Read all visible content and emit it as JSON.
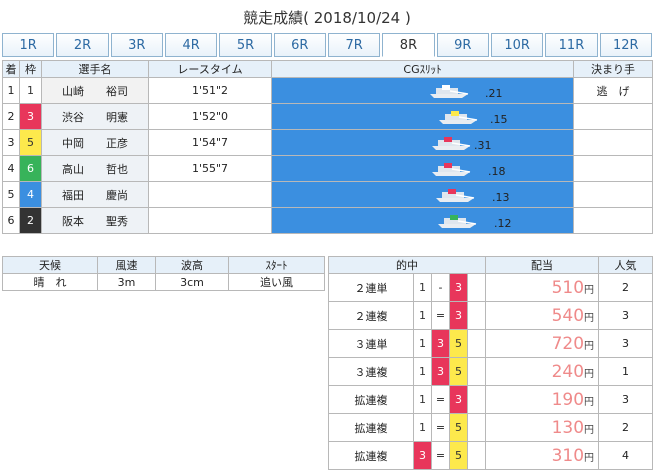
{
  "page": {
    "title": "競走成績( 2018/10/24 )"
  },
  "race_tabs": [
    {
      "label": "1R"
    },
    {
      "label": "2R"
    },
    {
      "label": "3R"
    },
    {
      "label": "4R"
    },
    {
      "label": "5R"
    },
    {
      "label": "6R"
    },
    {
      "label": "7R"
    },
    {
      "label": "8R",
      "active": true
    },
    {
      "label": "9R"
    },
    {
      "label": "10R"
    },
    {
      "label": "11R"
    },
    {
      "label": "12R"
    }
  ],
  "results": {
    "headers": {
      "rank": "着",
      "lane": "枠",
      "name": "選手名",
      "time": "レースタイム",
      "cg": "CGｽﾘｯﾄ",
      "kimarite": "決まり手"
    },
    "rows": [
      {
        "rank": "1",
        "lane": "1",
        "lane_color": "#ffffff",
        "name": "山崎　　裕司",
        "time": "1'51\"2",
        "slit": ".21",
        "kimarite": "逃　げ",
        "boat_color": "#ffffff"
      },
      {
        "rank": "2",
        "lane": "3",
        "lane_color": "#e8365b",
        "name": "渋谷　　明憲",
        "time": "1'52\"0",
        "slit": ".15",
        "kimarite": "",
        "boat_color": "#fde94c"
      },
      {
        "rank": "3",
        "lane": "5",
        "lane_color": "#fde94c",
        "name": "中岡　　正彦",
        "time": "1'54\"7",
        "slit": ".31",
        "kimarite": "",
        "boat_color": "#e8365b"
      },
      {
        "rank": "4",
        "lane": "6",
        "lane_color": "#37b35a",
        "name": "高山　　哲也",
        "time": "1'55\"7",
        "slit": ".18",
        "kimarite": "",
        "boat_color": "#e8365b"
      },
      {
        "rank": "5",
        "lane": "4",
        "lane_color": "#3b8fe0",
        "name": "福田　　慶尚",
        "time": "",
        "slit": ".13",
        "kimarite": "",
        "boat_color": "#e8365b"
      },
      {
        "rank": "6",
        "lane": "2",
        "lane_color": "#333333",
        "name": "阪本　　聖秀",
        "time": "",
        "slit": ".12",
        "kimarite": "",
        "boat_color": "#37b35a"
      }
    ]
  },
  "weather": {
    "headers": {
      "weather": "天候",
      "wind": "風速",
      "wave": "波高",
      "start": "ｽﾀｰﾄ"
    },
    "values": {
      "weather": "晴　れ",
      "wind": "3m",
      "wave": "3cm",
      "start": "追い風"
    }
  },
  "payout": {
    "headers": {
      "combo": "的中",
      "amount": "配当",
      "popularity": "人気"
    },
    "yen": "円",
    "rows": [
      {
        "type": "２連単",
        "a": "1",
        "sep": "-",
        "b": "3",
        "c": "",
        "amount": "510",
        "pop": "2",
        "a_lane": "1",
        "b_lane": "3",
        "c_lane": ""
      },
      {
        "type": "２連複",
        "a": "1",
        "sep": "=",
        "b": "3",
        "c": "",
        "amount": "540",
        "pop": "3",
        "a_lane": "1",
        "b_lane": "3",
        "c_lane": ""
      },
      {
        "type": "３連単",
        "a": "1",
        "sep": "3",
        "b": "5",
        "c": "",
        "amount": "720",
        "pop": "3",
        "a_lane": "1",
        "b_lane": "5",
        "c_lane": "",
        "sep_lane": "3"
      },
      {
        "type": "３連複",
        "a": "1",
        "sep": "3",
        "b": "5",
        "c": "",
        "amount": "240",
        "pop": "1",
        "a_lane": "1",
        "b_lane": "5",
        "c_lane": "",
        "sep_lane": "3"
      },
      {
        "type": "拡連複",
        "a": "1",
        "sep": "=",
        "b": "3",
        "c": "",
        "amount": "190",
        "pop": "3",
        "a_lane": "1",
        "b_lane": "3",
        "c_lane": ""
      },
      {
        "type": "拡連複",
        "a": "1",
        "sep": "=",
        "b": "5",
        "c": "",
        "amount": "130",
        "pop": "2",
        "a_lane": "1",
        "b_lane": "5",
        "c_lane": ""
      },
      {
        "type": "拡連複",
        "a": "3",
        "sep": "=",
        "b": "5",
        "c": "",
        "amount": "310",
        "pop": "4",
        "a_lane": "3",
        "b_lane": "5",
        "c_lane": ""
      }
    ]
  }
}
